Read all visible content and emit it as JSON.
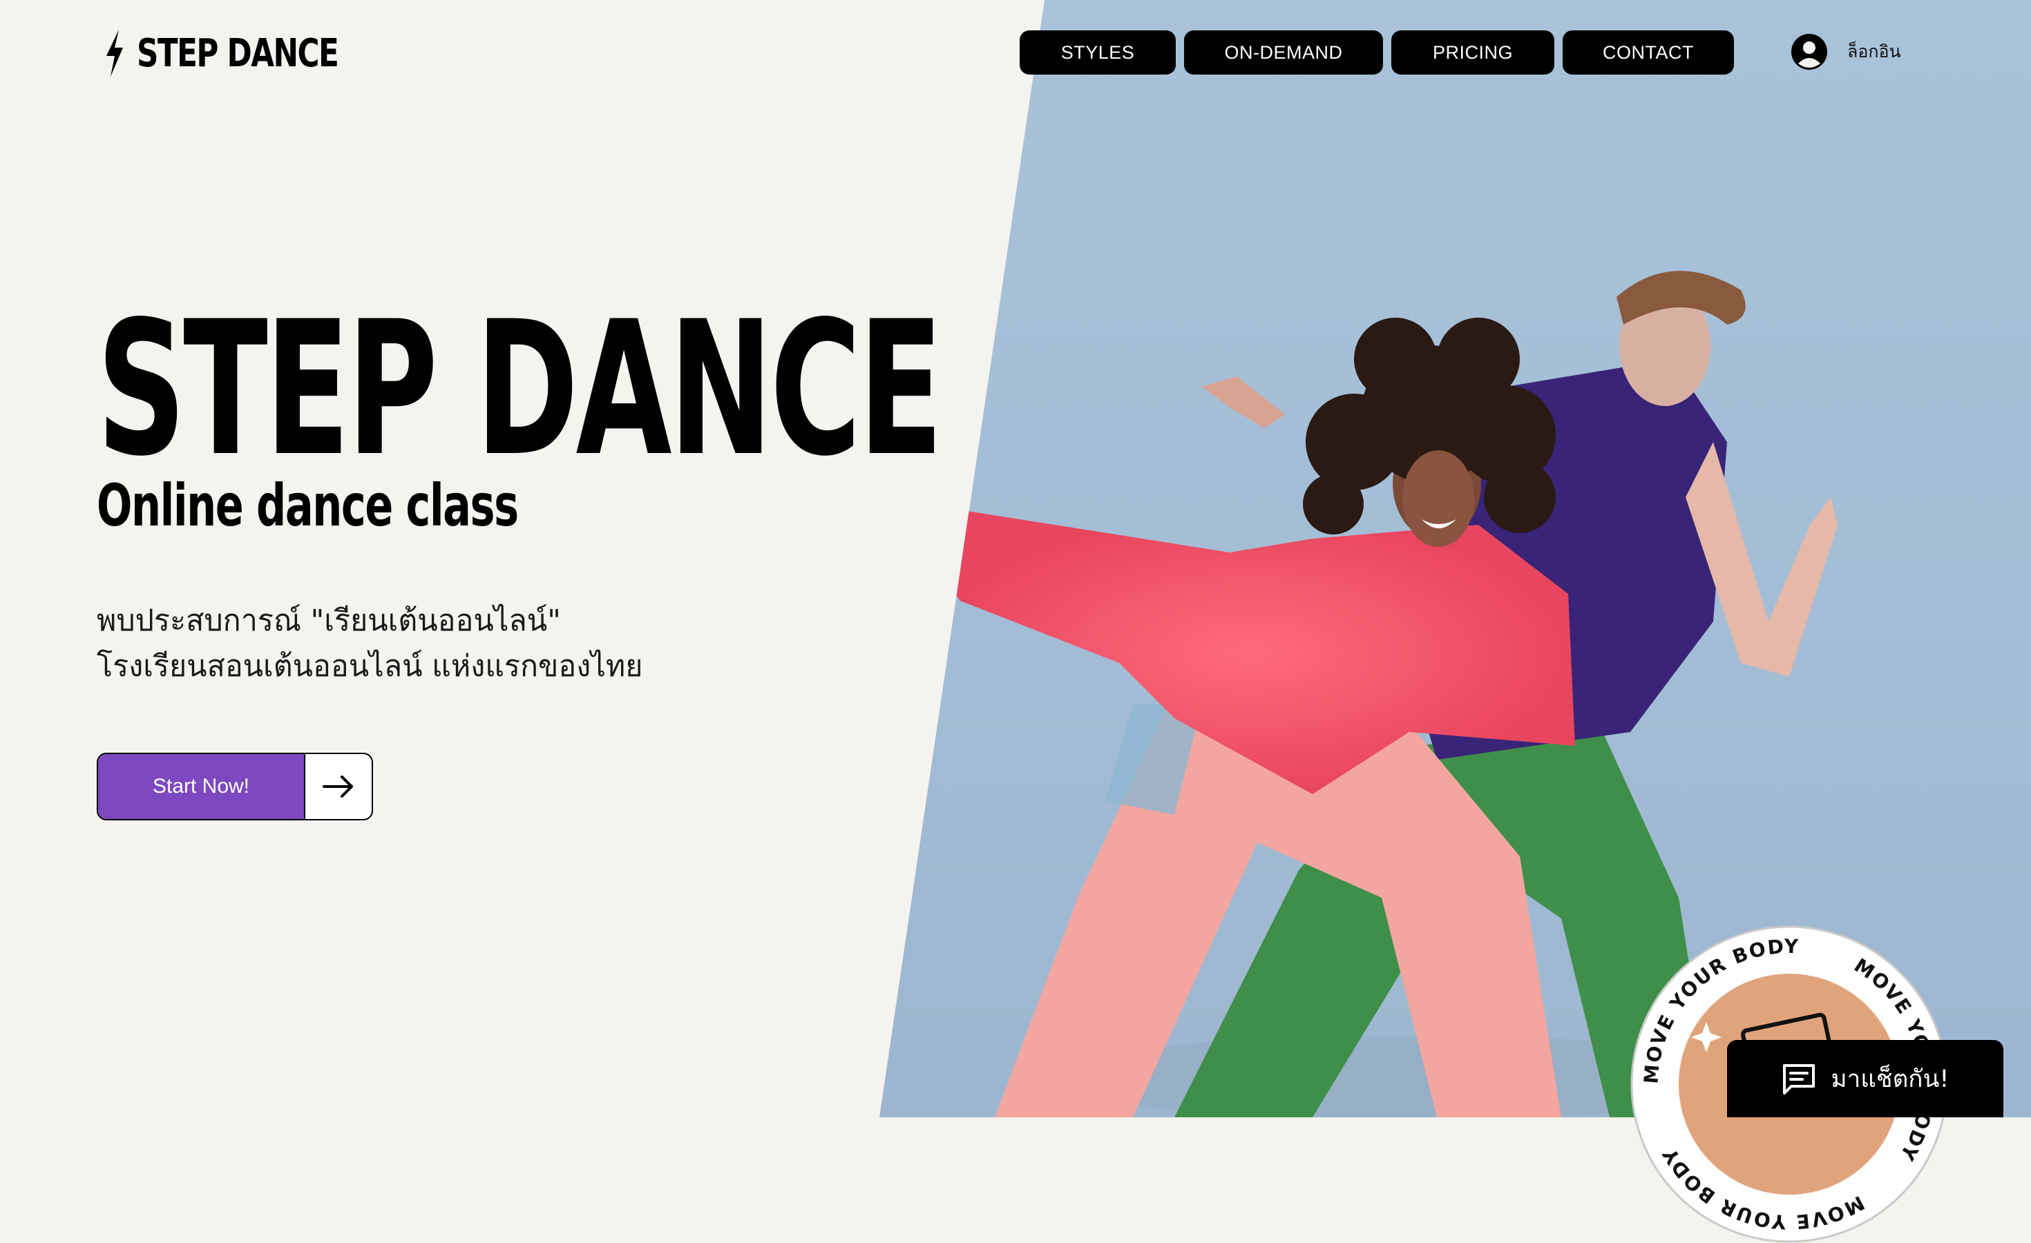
{
  "brand": {
    "logo_text": "STEP DANCE",
    "logo_icon": "lightning-bolt-icon"
  },
  "nav": {
    "items": [
      {
        "label": "STYLES"
      },
      {
        "label": "ON-DEMAND"
      },
      {
        "label": "PRICING"
      },
      {
        "label": "CONTACT"
      }
    ],
    "login_label": "ล็อกอิน",
    "login_icon": "user-avatar-icon"
  },
  "hero": {
    "title": "STEP DANCE",
    "subtitle": "Online dance class",
    "description_line1": "พบประสบการณ์ \"เรียนเต้นออนไลน์\"",
    "description_line2": "โรงเรียนสอนเต้นออนไลน์ แห่งแรกของไทย",
    "cta_label": "Start Now!",
    "cta_icon": "arrow-right-icon",
    "accent_color": "#7d48c0",
    "photo": "two-dancers-photo"
  },
  "badge": {
    "text": "MOVE YOUR BODY"
  },
  "chat": {
    "label": "มาแช็ตกัน!",
    "icon": "chat-icon"
  }
}
